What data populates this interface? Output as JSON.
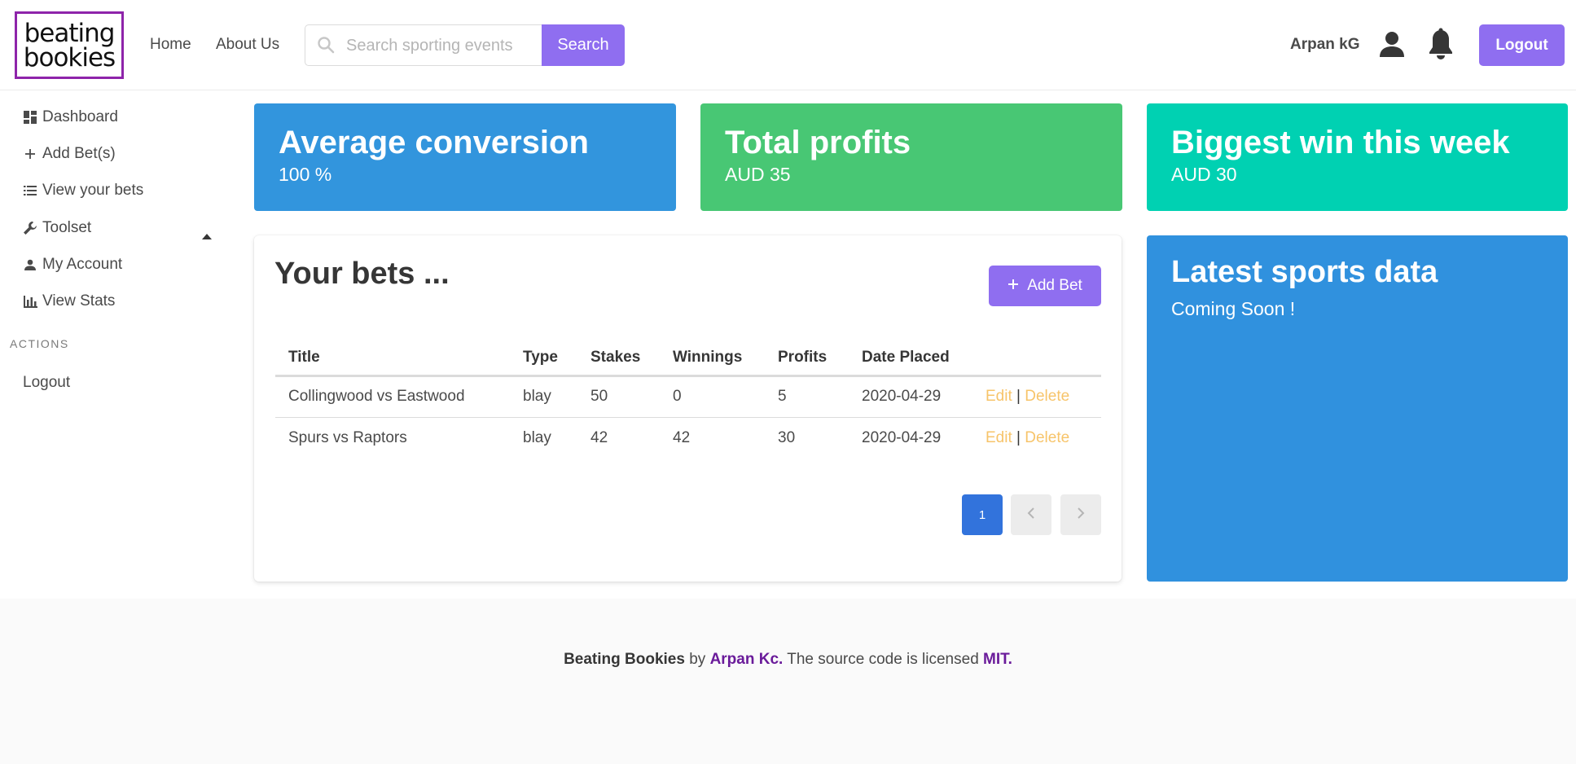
{
  "brand": {
    "logo_line1": "beating",
    "logo_line2": "bookies"
  },
  "nav": {
    "home": "Home",
    "about": "About Us",
    "search_placeholder": "Search sporting events",
    "search_button": "Search",
    "user_name": "Arpan kG",
    "logout": "Logout"
  },
  "sidebar": {
    "items": [
      {
        "label": "Dashboard",
        "icon": "dashboard-icon"
      },
      {
        "label": "Add Bet(s)",
        "icon": "plus-icon"
      },
      {
        "label": "View your bets",
        "icon": "list-icon"
      },
      {
        "label": "Toolset",
        "icon": "wrench-icon"
      },
      {
        "label": "My Account",
        "icon": "user-icon"
      },
      {
        "label": "View Stats",
        "icon": "bar-chart-icon"
      }
    ],
    "actions_label": "ACTIONS",
    "logout": "Logout"
  },
  "stats": [
    {
      "title": "Average conversion",
      "value": "100 %",
      "color": "#3295dd"
    },
    {
      "title": "Total profits",
      "value": "AUD 35",
      "color": "#48c774"
    },
    {
      "title": "Biggest win this week",
      "value": "AUD 30",
      "color": "#00d1b2"
    }
  ],
  "bets": {
    "title": "Your bets ...",
    "add_button": "Add Bet",
    "columns": [
      "Title",
      "Type",
      "Stakes",
      "Winnings",
      "Profits",
      "Date Placed"
    ],
    "rows": [
      {
        "title": "Collingwood vs Eastwood",
        "type": "blay",
        "stakes": "50",
        "winnings": "0",
        "profits": "5",
        "date": "2020-04-29",
        "edit": "Edit",
        "sep": "|",
        "delete": "Delete"
      },
      {
        "title": "Spurs vs Raptors",
        "type": "blay",
        "stakes": "42",
        "winnings": "42",
        "profits": "30",
        "date": "2020-04-29",
        "edit": "Edit",
        "sep": "|",
        "delete": "Delete"
      }
    ],
    "current_page": "1"
  },
  "sports": {
    "title": "Latest sports data",
    "subtitle": "Coming Soon !"
  },
  "footer": {
    "app": "Beating Bookies",
    "by": " by ",
    "author": "Arpan Kc.",
    "text": " The source code is licensed ",
    "license": "MIT."
  }
}
